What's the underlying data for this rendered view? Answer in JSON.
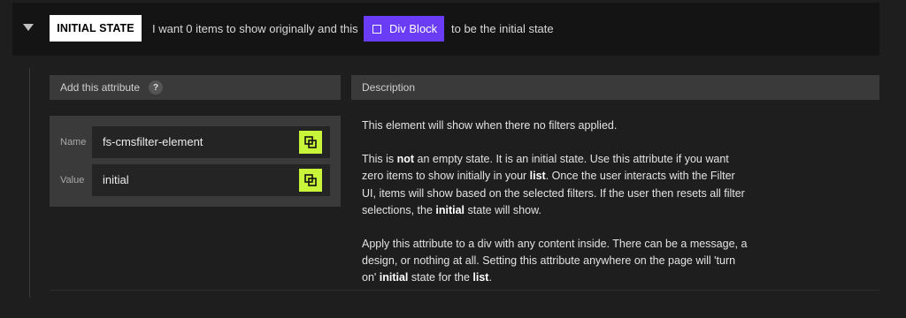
{
  "header": {
    "toggle_icon": "caret-down-icon",
    "state_label": "INITIAL STATE",
    "intro_text": "I want 0 items to show originally and this",
    "element_chip": {
      "icon": "square-icon",
      "label": "Div Block",
      "color": "#6b3cf5"
    },
    "outro_text": "to be the initial state"
  },
  "attribute_panel": {
    "title": "Add this attribute",
    "help_label": "?",
    "rows": [
      {
        "label": "Name",
        "value": "fs-cmsfilter-element",
        "copy_icon": "copy-icon"
      },
      {
        "label": "Value",
        "value": "initial",
        "copy_icon": "copy-icon"
      }
    ],
    "copy_button_color": "#c8f53a"
  },
  "description_panel": {
    "title": "Description",
    "paragraphs": [
      [
        {
          "t": "This element will show when there no filters applied."
        }
      ],
      [
        {
          "t": "This is "
        },
        {
          "t": "not",
          "b": true
        },
        {
          "t": " an empty state. It is an initial state. Use this attribute if you want zero items to show initially in your "
        },
        {
          "t": "list",
          "b": true
        },
        {
          "t": ". Once the user interacts with the Filter UI, items will show based on the selected filters. If the user then resets all filter selections, the "
        },
        {
          "t": "initial",
          "b": true
        },
        {
          "t": " state will show."
        }
      ],
      [
        {
          "t": "Apply this attribute to a div with any content inside. There can be a message, a design, or nothing at all. Setting this attribute anywhere on the page will 'turn on' "
        },
        {
          "t": "initial",
          "b": true
        },
        {
          "t": " state for the "
        },
        {
          "t": "list",
          "b": true
        },
        {
          "t": "."
        }
      ]
    ]
  }
}
